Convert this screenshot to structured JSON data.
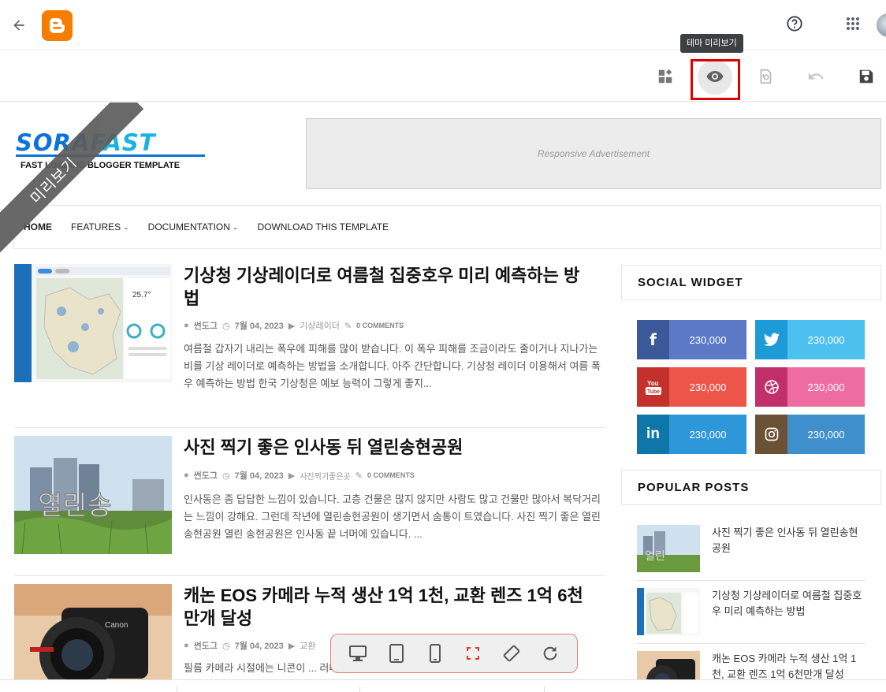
{
  "tooltip": "테마 미리보기",
  "ribbon": "미리보기",
  "logo": {
    "text_a": "SORA",
    "text_b": "FAST",
    "subtitle": "FAST LOADING BLOGGER TEMPLATE"
  },
  "ad": {
    "text": "Responsive Advertisement"
  },
  "nav": {
    "home": "HOME",
    "features": "FEATURES",
    "documentation": "DOCUMENTATION",
    "download": "DOWNLOAD THIS TEMPLATE"
  },
  "posts": [
    {
      "title": "기상청 기상레이더로 여름철 집중호우 미리 예측하는 방법",
      "author": "썬도그",
      "date": "7월 04, 2023",
      "label": "기상레이더",
      "comments": "0 COMMENTS",
      "excerpt": "여름철 갑자기 내리는 폭우에 피해를 많이 받습니다. 이 폭우 피해를 조금이라도 줄이거나 지나가는 비를 기상 레이더로 예측하는 방법을 소개합니다. 아주 간단합니다.  기상청 레이더 이용해서 여름 폭우 예측하는 방법 한국 기상청은 예보 능력이 그렇게 좋지..."
    },
    {
      "title": "사진 찍기 좋은 인사동 뒤 열린송현공원",
      "author": "썬도그",
      "date": "7월 04, 2023",
      "label": "사진찍기좋은곳",
      "comments": "0 COMMENTS",
      "excerpt": "인사동은 좀 답답한 느낌이 있습니다. 고층 건물은 많지 않지만 사람도 많고 건물만 많아서 복닥거리는 느낌이 강해요. 그런데 작년에 열린송현공원이 생기면서 숨통이 트였습니다.  사진 찍기 좋은 열린 송현공원 열린 송현공원은 인사동 끝 너머에 있습니다. ..."
    },
    {
      "title": "캐논 EOS 카메라 누적 생산 1억 1천, 교환 렌즈 1억 6천만개 달성",
      "author": "썬도그",
      "date": "7월 04, 2023",
      "label": "교환",
      "comments": "",
      "excerpt": "필름 카메라 시절에는 니콘이 ... 러나"
    }
  ],
  "sidebar": {
    "social_title": "SOCIAL WIDGET",
    "social": [
      {
        "name": "facebook",
        "icon": "f",
        "count": "230,000",
        "c1": "#3b5998",
        "c2": "#5b79c6"
      },
      {
        "name": "twitter",
        "icon": "t",
        "count": "230,000",
        "c1": "#1d9bd7",
        "c2": "#4cc0ee"
      },
      {
        "name": "youtube",
        "icon": "You Tube",
        "count": "230,000",
        "c1": "#c4302b",
        "c2": "#ee5549"
      },
      {
        "name": "dribbble",
        "icon": "d",
        "count": "230,000",
        "c1": "#c2306b",
        "c2": "#ee6da0"
      },
      {
        "name": "linkedin",
        "icon": "in",
        "count": "230,000",
        "c1": "#0e76a8",
        "c2": "#2d97d9"
      },
      {
        "name": "instagram",
        "icon": "ig",
        "count": "230,000",
        "c1": "#6b5136",
        "c2": "#3f8fcc"
      }
    ],
    "popular_title": "POPULAR POSTS",
    "popular": [
      "사진 찍기 좋은 인사동 뒤 열린송현공원",
      "기상청 기상레이더로 여름철 집중호우 미리 예측하는 방법",
      "캐논 EOS 카메라 누적 생산 1억 1천, 교환 렌즈 1억 6천만개 달성"
    ]
  },
  "icons": {
    "back": "back-arrow-icon",
    "help": "help-icon",
    "apps": "apps-grid-icon",
    "layout": "layout-icon",
    "preview": "eye-icon",
    "restore": "restore-icon",
    "undo": "undo-icon",
    "save": "save-icon"
  },
  "colors": {
    "blogger": "#f57d00",
    "highlight": "#e00000",
    "accent": "#0a73d9"
  }
}
